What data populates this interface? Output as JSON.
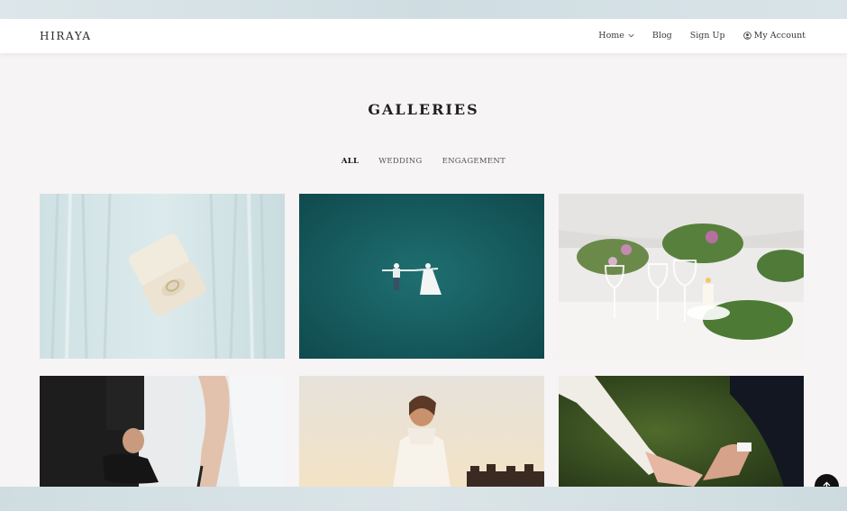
{
  "brand": "HIRAYA",
  "nav": {
    "home": "Home",
    "blog": "Blog",
    "signup": "Sign Up",
    "account": "My Account"
  },
  "page_title": "GALLERIES",
  "filters": [
    "ALL",
    "WEDDING",
    "ENGAGEMENT"
  ],
  "active_filter": "ALL",
  "gallery": [
    {
      "subject": "engagement ring box on pale blue fabric"
    },
    {
      "subject": "aerial view of couple lying on turquoise water"
    },
    {
      "subject": "wedding table setting with glasses, candles and flowers"
    },
    {
      "subject": "groom holding shoes beside bride"
    },
    {
      "subject": "bride at sunset in front of building"
    },
    {
      "subject": "couple holding hands outdoors"
    }
  ],
  "icons": {
    "home_dropdown": "chevron-down-icon",
    "account": "user-circle-icon",
    "back_to_top": "arrow-up-icon"
  },
  "colors": {
    "navbar_bg": "#ffffff",
    "page_bg": "#f6f4f4",
    "text": "#1f1f1f",
    "back_to_top_bg": "#111111"
  }
}
